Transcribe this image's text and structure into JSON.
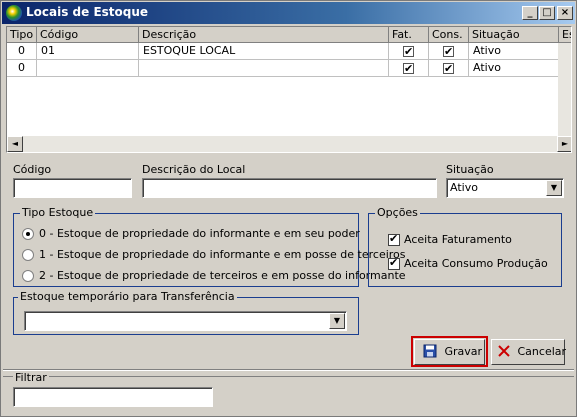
{
  "window": {
    "title": "Locais de Estoque",
    "minimize": "_",
    "maximize": "□",
    "close": "×"
  },
  "grid": {
    "columns": [
      "Tipo",
      "Código",
      "Descrição",
      "Fat.",
      "Cons.",
      "Situação",
      "Es"
    ],
    "rows": [
      {
        "tipo": "0",
        "codigo": "01",
        "descricao": "ESTOQUE LOCAL",
        "fat": true,
        "cons": true,
        "situacao": "Ativo"
      },
      {
        "tipo": "0",
        "codigo": "",
        "descricao": "",
        "fat": true,
        "cons": true,
        "situacao": "Ativo"
      }
    ],
    "scroll_left": "◄",
    "scroll_right": "►"
  },
  "form": {
    "codigo_label": "Código",
    "codigo_value": "",
    "descricao_label": "Descrição do Local",
    "descricao_value": "",
    "situacao_label": "Situação",
    "situacao_value": "Ativo",
    "dropdown_arrow": "▼"
  },
  "tipo_estoque": {
    "title": "Tipo Estoque",
    "options": [
      {
        "label": "0 - Estoque de propriedade do informante e em seu poder",
        "selected": true
      },
      {
        "label": "1 - Estoque de propriedade do informante e em posse de terceiros",
        "selected": false
      },
      {
        "label": "2 - Estoque de propriedade de terceiros e em posse do informante",
        "selected": false
      }
    ]
  },
  "opcoes": {
    "title": "Opções",
    "aceita_faturamento": "Aceita Faturamento",
    "aceita_consumo": "Aceita Consumo Produção"
  },
  "transferencia": {
    "title": "Estoque temporário para Transferência",
    "value": ""
  },
  "buttons": {
    "gravar": "Gravar",
    "cancelar": "Cancelar"
  },
  "filtro": {
    "label": "Filtrar",
    "value": ""
  },
  "colors": {
    "title_start": "#0a246a",
    "group_border": "#1a3d8f",
    "highlight": "#cc0000",
    "face": "#d4d0c8"
  }
}
